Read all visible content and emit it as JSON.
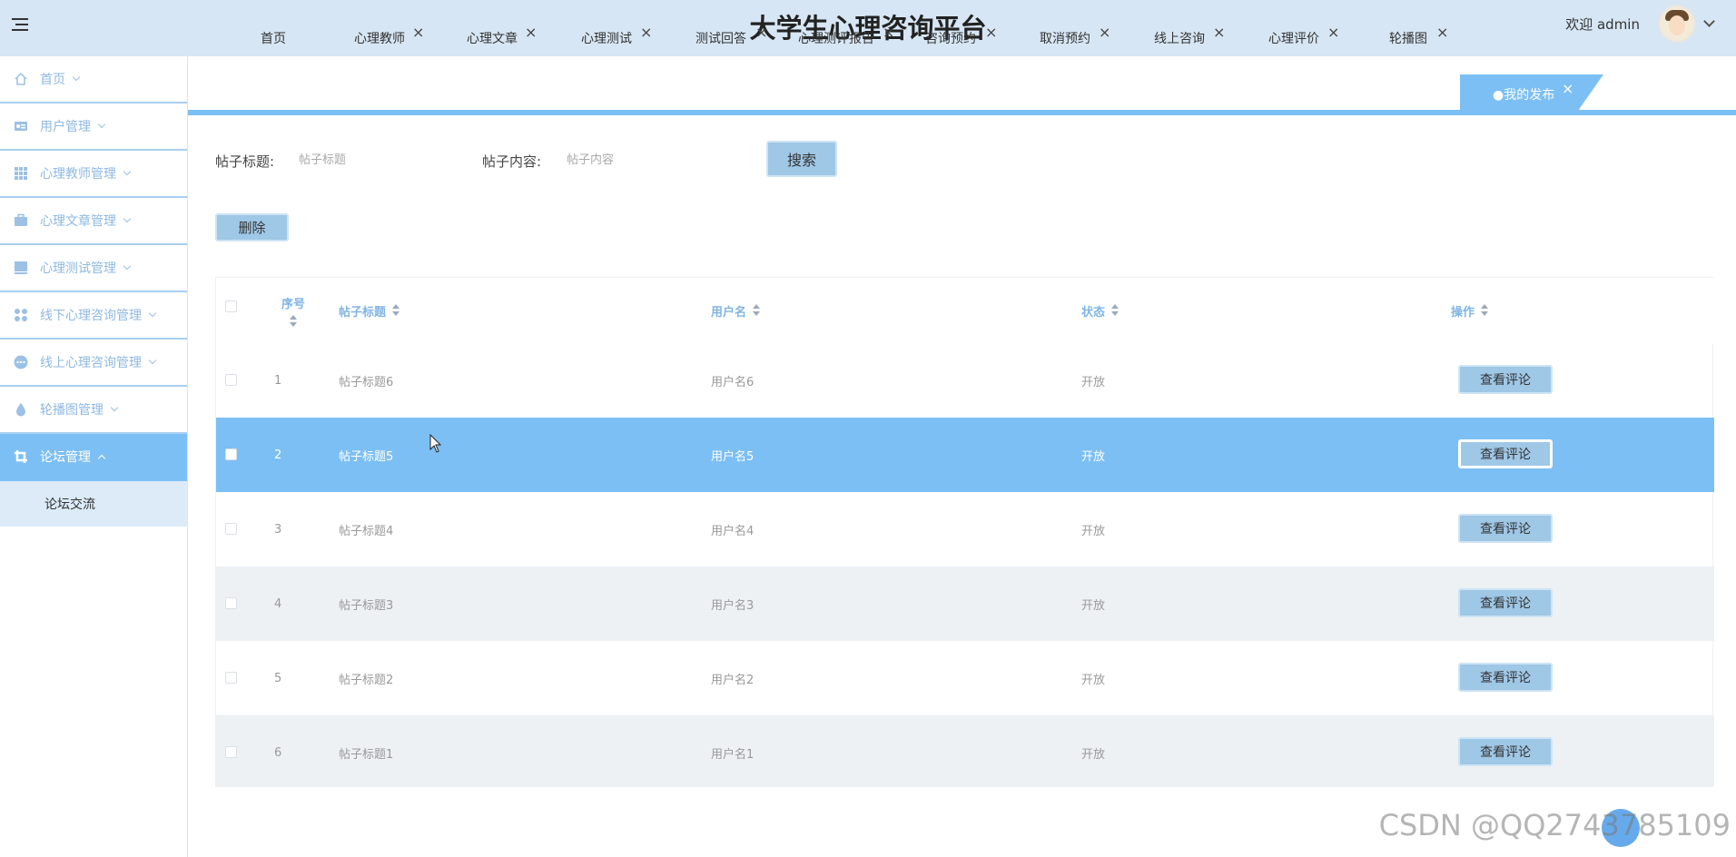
{
  "header": {
    "title": "大学生心理咨询平台",
    "welcome": "欢迎 admin"
  },
  "sidebar": {
    "items": [
      {
        "label": "首页",
        "icon": "home-icon"
      },
      {
        "label": "用户管理",
        "icon": "id-card-icon"
      },
      {
        "label": "心理教师管理",
        "icon": "grid-icon"
      },
      {
        "label": "心理文章管理",
        "icon": "briefcase-icon"
      },
      {
        "label": "心理测试管理",
        "icon": "monitor-icon"
      },
      {
        "label": "线下心理咨询管理",
        "icon": "apps-icon"
      },
      {
        "label": "线上心理咨询管理",
        "icon": "chat-dots-icon"
      },
      {
        "label": "轮播图管理",
        "icon": "drop-icon"
      },
      {
        "label": "论坛管理",
        "icon": "crop-icon"
      }
    ],
    "submenu": [
      "论坛交流"
    ]
  },
  "tabs": [
    {
      "label": "首页"
    },
    {
      "label": "心理教师"
    },
    {
      "label": "心理文章"
    },
    {
      "label": "心理测试"
    },
    {
      "label": "测试回答"
    },
    {
      "label": "心理测评报告"
    },
    {
      "label": "咨询预约"
    },
    {
      "label": "取消预约"
    },
    {
      "label": "线上咨询"
    },
    {
      "label": "心理评价"
    },
    {
      "label": "轮播图"
    },
    {
      "label": "●我的发布"
    }
  ],
  "search": {
    "title_label": "帖子标题:",
    "title_placeholder": "帖子标题",
    "content_label": "帖子内容:",
    "content_placeholder": "帖子内容",
    "search_button": "搜索",
    "delete_button": "删除"
  },
  "table": {
    "headers": [
      "序号",
      "帖子标题",
      "用户名",
      "状态",
      "操作"
    ],
    "rows": [
      {
        "index": "1",
        "title": "帖子标题6",
        "user": "用户名6",
        "status": "开放",
        "action": "查看评论"
      },
      {
        "index": "2",
        "title": "帖子标题5",
        "user": "用户名5",
        "status": "开放",
        "action": "查看评论"
      },
      {
        "index": "3",
        "title": "帖子标题4",
        "user": "用户名4",
        "status": "开放",
        "action": "查看评论"
      },
      {
        "index": "4",
        "title": "帖子标题3",
        "user": "用户名3",
        "status": "开放",
        "action": "查看评论"
      },
      {
        "index": "5",
        "title": "帖子标题2",
        "user": "用户名2",
        "status": "开放",
        "action": "查看评论"
      },
      {
        "index": "6",
        "title": "帖子标题1",
        "user": "用户名1",
        "status": "开放",
        "action": "查看评论"
      }
    ]
  },
  "watermark": "CSDN @QQ2743785109",
  "colors": {
    "accent": "#7cbff4",
    "header_bg": "#d7e6f4",
    "button_bg": "#9fc7e6",
    "sidebar_text": "#8fb8e2"
  }
}
